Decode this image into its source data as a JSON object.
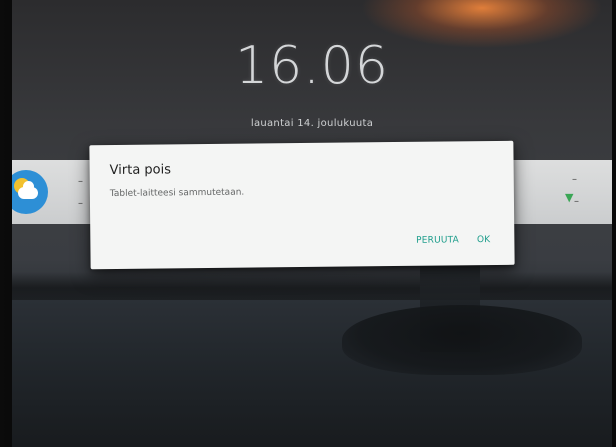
{
  "lockscreen": {
    "time": "16.06",
    "date": "lauantai 14. joulukuuta"
  },
  "widget": {
    "weather_icon": "partly-cloudy-icon",
    "left_dash_top": "–",
    "left_dash_bottom": "–",
    "right_dash_top": "–",
    "right_dash_bottom": "–",
    "pin_icon": "map-pin-icon"
  },
  "dialog": {
    "title": "Virta pois",
    "message": "Tablet-laitteesi sammutetaan.",
    "cancel_label": "PERUUTA",
    "ok_label": "OK"
  },
  "colors": {
    "accent": "#1f9e8c",
    "weather_blue": "#2d8fd6",
    "sun_yellow": "#f2c12e",
    "pin_green": "#3aa655"
  }
}
